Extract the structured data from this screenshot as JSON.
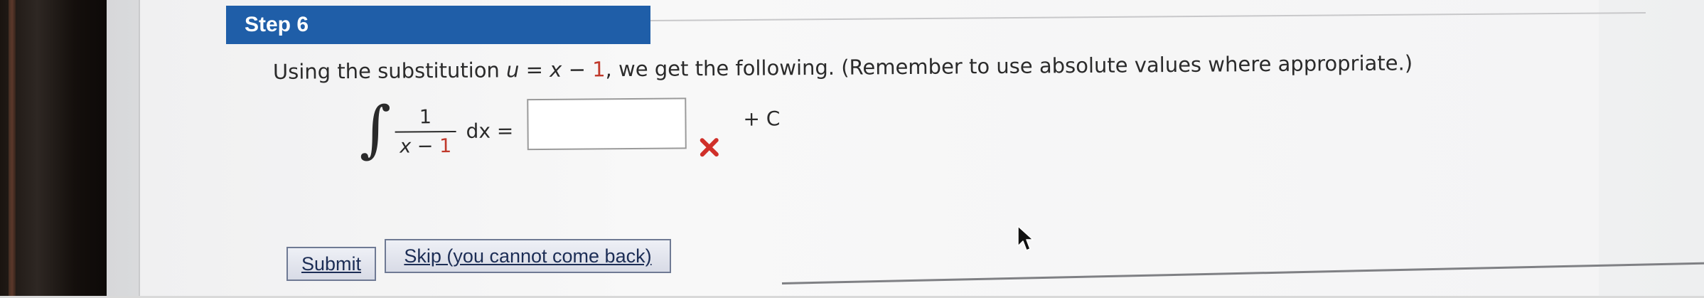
{
  "step": {
    "title": "Step 6"
  },
  "problem": {
    "instruction_prefix": "Using the substitution ",
    "sub_var": "u",
    "sub_eq": " = ",
    "sub_x": "x",
    "sub_minus": " − ",
    "sub_one": "1",
    "instruction_suffix": ", we get the following. (Remember to use absolute values where appropriate.)"
  },
  "equation": {
    "integral_sign": "∫",
    "numerator": "1",
    "den_x": "x",
    "den_minus": " − ",
    "den_one": "1",
    "dx": "dx =",
    "answer_value": "",
    "answer_status": "incorrect",
    "plus_c": "+ C"
  },
  "buttons": {
    "submit_label": "Submit",
    "skip_label": "Skip (you cannot come back)"
  },
  "colors": {
    "header_blue": "#1f5ea8",
    "error_red": "#d0302a",
    "highlight_red": "#c0392b"
  },
  "icons": {
    "incorrect": "x-mark-icon",
    "pointer": "mouse-cursor-icon"
  }
}
